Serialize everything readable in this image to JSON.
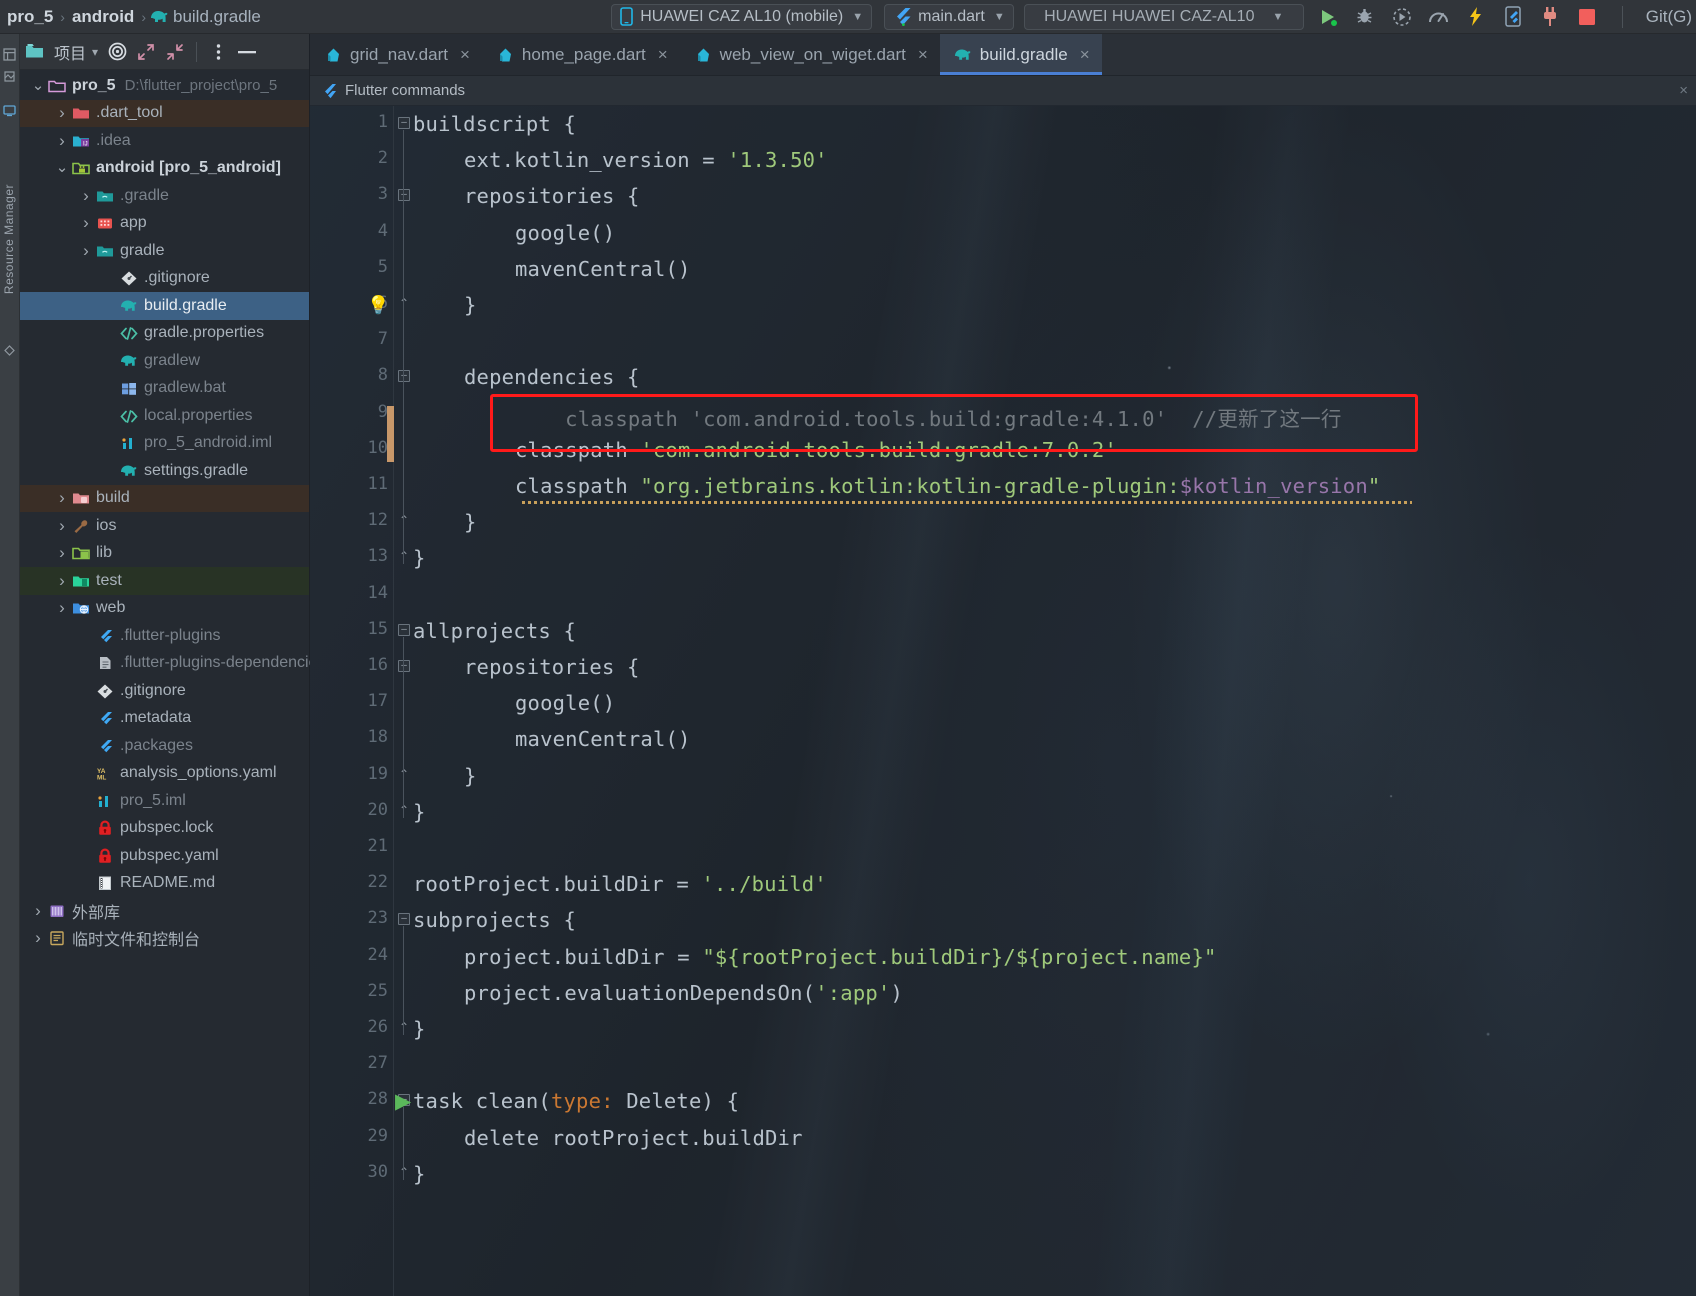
{
  "toolbar": {
    "breadcrumb": [
      {
        "label": "pro_5",
        "type": "project"
      },
      {
        "label": "android",
        "type": "module"
      },
      {
        "label": "build.gradle",
        "type": "file",
        "icon": "gradle-elephant-icon"
      }
    ],
    "device_selector": {
      "label": "HUAWEI CAZ AL10 (mobile)",
      "icon": "phone-icon"
    },
    "config_selector": {
      "label": "main.dart",
      "icon": "flutter-icon"
    },
    "target_selector": {
      "label": "HUAWEI HUAWEI CAZ-AL10"
    },
    "actions": [
      {
        "name": "run-button",
        "icon": "play-icon",
        "color": "#7dc87d"
      },
      {
        "name": "debug-button",
        "icon": "bug-icon",
        "color": "#9aa4ae"
      },
      {
        "name": "profile-button",
        "icon": "profile-clock-icon",
        "color": "#9aa4ae"
      },
      {
        "name": "performance-button",
        "icon": "gauge-icon",
        "color": "#9aa4ae"
      },
      {
        "name": "hot-reload-button",
        "icon": "lightning-icon",
        "color": "#f5c518"
      },
      {
        "name": "open-devtools-button",
        "icon": "device-flutter-icon",
        "color": "#76a9dd"
      },
      {
        "name": "attach-debugger-button",
        "icon": "plug-icon",
        "color": "#e08b82"
      },
      {
        "name": "stop-button",
        "icon": "stop-square-icon",
        "color": "#f25f5c"
      }
    ],
    "git_label": "Git(G)"
  },
  "rail": {
    "label": "Resource Manager"
  },
  "project_panel": {
    "title": "项目",
    "header_icons": [
      {
        "name": "project-view-icon"
      },
      {
        "name": "chevron-down-icon"
      },
      {
        "name": "target-locate-icon"
      },
      {
        "name": "expand-all-icon"
      },
      {
        "name": "collapse-all-icon"
      },
      {
        "name": "more-options-icon"
      },
      {
        "name": "hide-panel-icon"
      }
    ],
    "tree": [
      {
        "label": "pro_5",
        "sub": "D:\\flutter_project\\pro_5",
        "indent": 0,
        "arrow": "down",
        "icon": "folder-project-icon",
        "bold": true,
        "state": "normal"
      },
      {
        "label": ".dart_tool",
        "sub": "",
        "indent": 1,
        "arrow": "right",
        "icon": "folder-red-icon",
        "bold": false,
        "state": "build"
      },
      {
        "label": ".idea",
        "sub": "",
        "indent": 1,
        "arrow": "right",
        "icon": "folder-idea-icon",
        "bold": false,
        "state": "dim"
      },
      {
        "label": "android [pro_5_android]",
        "sub": "",
        "indent": 1,
        "arrow": "down",
        "icon": "folder-android-icon",
        "bold": true,
        "state": "normal"
      },
      {
        "label": ".gradle",
        "sub": "",
        "indent": 2,
        "arrow": "right",
        "icon": "folder-gradle-icon",
        "bold": false,
        "state": "dim"
      },
      {
        "label": "app",
        "sub": "",
        "indent": 2,
        "arrow": "right",
        "icon": "module-app-icon",
        "bold": false,
        "state": "normal"
      },
      {
        "label": "gradle",
        "sub": "",
        "indent": 2,
        "arrow": "right",
        "icon": "folder-gradle-icon",
        "bold": false,
        "state": "normal"
      },
      {
        "label": ".gitignore",
        "sub": "",
        "indent": 3,
        "arrow": "",
        "icon": "git-icon",
        "bold": false,
        "state": "normal"
      },
      {
        "label": "build.gradle",
        "sub": "",
        "indent": 3,
        "arrow": "",
        "icon": "gradle-elephant-icon",
        "bold": false,
        "state": "selected"
      },
      {
        "label": "gradle.properties",
        "sub": "",
        "indent": 3,
        "arrow": "",
        "icon": "code-tag-icon",
        "bold": false,
        "state": "normal"
      },
      {
        "label": "gradlew",
        "sub": "",
        "indent": 3,
        "arrow": "",
        "icon": "gradle-elephant-icon",
        "bold": false,
        "state": "dim"
      },
      {
        "label": "gradlew.bat",
        "sub": "",
        "indent": 3,
        "arrow": "",
        "icon": "windows-icon",
        "bold": false,
        "state": "dim"
      },
      {
        "label": "local.properties",
        "sub": "",
        "indent": 3,
        "arrow": "",
        "icon": "code-tag-icon",
        "bold": false,
        "state": "dim"
      },
      {
        "label": "pro_5_android.iml",
        "sub": "",
        "indent": 3,
        "arrow": "",
        "icon": "iml-icon",
        "bold": false,
        "state": "dim"
      },
      {
        "label": "settings.gradle",
        "sub": "",
        "indent": 3,
        "arrow": "",
        "icon": "gradle-elephant-icon",
        "bold": false,
        "state": "normal"
      },
      {
        "label": "build",
        "sub": "",
        "indent": 1,
        "arrow": "right",
        "icon": "folder-build-icon",
        "bold": false,
        "state": "build"
      },
      {
        "label": "ios",
        "sub": "",
        "indent": 1,
        "arrow": "right",
        "icon": "wrench-icon",
        "bold": false,
        "state": "normal"
      },
      {
        "label": "lib",
        "sub": "",
        "indent": 1,
        "arrow": "right",
        "icon": "folder-source-icon",
        "bold": false,
        "state": "normal"
      },
      {
        "label": "test",
        "sub": "",
        "indent": 1,
        "arrow": "right",
        "icon": "folder-test-icon",
        "bold": false,
        "state": "test"
      },
      {
        "label": "web",
        "sub": "",
        "indent": 1,
        "arrow": "right",
        "icon": "folder-web-icon",
        "bold": false,
        "state": "normal"
      },
      {
        "label": ".flutter-plugins",
        "sub": "",
        "indent": 2,
        "arrow": "",
        "icon": "flutter-icon",
        "bold": false,
        "state": "dim"
      },
      {
        "label": ".flutter-plugins-dependencies",
        "sub": "",
        "indent": 2,
        "arrow": "",
        "icon": "file-icon",
        "bold": false,
        "state": "dim"
      },
      {
        "label": ".gitignore",
        "sub": "",
        "indent": 2,
        "arrow": "",
        "icon": "git-icon",
        "bold": false,
        "state": "normal"
      },
      {
        "label": ".metadata",
        "sub": "",
        "indent": 2,
        "arrow": "",
        "icon": "flutter-icon",
        "bold": false,
        "state": "normal"
      },
      {
        "label": ".packages",
        "sub": "",
        "indent": 2,
        "arrow": "",
        "icon": "flutter-icon",
        "bold": false,
        "state": "dim"
      },
      {
        "label": "analysis_options.yaml",
        "sub": "",
        "indent": 2,
        "arrow": "",
        "icon": "yaml-icon",
        "bold": false,
        "state": "normal"
      },
      {
        "label": "pro_5.iml",
        "sub": "",
        "indent": 2,
        "arrow": "",
        "icon": "iml-icon",
        "bold": false,
        "state": "dim"
      },
      {
        "label": "pubspec.lock",
        "sub": "",
        "indent": 2,
        "arrow": "",
        "icon": "lock-icon",
        "bold": false,
        "state": "normal"
      },
      {
        "label": "pubspec.yaml",
        "sub": "",
        "indent": 2,
        "arrow": "",
        "icon": "lock-icon",
        "bold": false,
        "state": "normal"
      },
      {
        "label": "README.md",
        "sub": "",
        "indent": 2,
        "arrow": "",
        "icon": "readme-icon",
        "bold": false,
        "state": "normal"
      },
      {
        "label": "外部库",
        "sub": "",
        "indent": 0,
        "arrow": "right",
        "icon": "external-lib-icon",
        "bold": false,
        "state": "normal"
      },
      {
        "label": "临时文件和控制台",
        "sub": "",
        "indent": 0,
        "arrow": "right",
        "icon": "scratches-icon",
        "bold": false,
        "state": "normal"
      }
    ]
  },
  "editor": {
    "tabs": [
      {
        "label": "grid_nav.dart",
        "icon": "dart-icon",
        "active": false,
        "closable": true
      },
      {
        "label": "home_page.dart",
        "icon": "dart-icon",
        "active": false,
        "closable": true
      },
      {
        "label": "web_view_on_wiget.dart",
        "icon": "dart-icon",
        "active": false,
        "closable": true
      },
      {
        "label": "build.gradle",
        "icon": "gradle-elephant-icon",
        "active": true,
        "closable": true
      }
    ],
    "notification_bar": {
      "label": "Flutter commands",
      "icon": "flutter-icon",
      "close": "×"
    },
    "lines": [
      {
        "n": 1,
        "indent": 0,
        "tokens": [
          {
            "t": "buildscript {",
            "c": "c-def"
          }
        ]
      },
      {
        "n": 2,
        "indent": 2,
        "tokens": [
          {
            "t": "ext.kotlin_version = ",
            "c": "c-def"
          },
          {
            "t": "'1.3.50'",
            "c": "c-str"
          }
        ]
      },
      {
        "n": 3,
        "indent": 2,
        "tokens": [
          {
            "t": "repositories {",
            "c": "c-def"
          }
        ]
      },
      {
        "n": 4,
        "indent": 4,
        "tokens": [
          {
            "t": "google()",
            "c": "c-def"
          }
        ]
      },
      {
        "n": 5,
        "indent": 4,
        "tokens": [
          {
            "t": "mavenCentral()",
            "c": "c-def"
          }
        ]
      },
      {
        "n": 6,
        "indent": 2,
        "tokens": [
          {
            "t": "}",
            "c": "c-def"
          }
        ]
      },
      {
        "n": 7,
        "indent": 0,
        "tokens": []
      },
      {
        "n": 8,
        "indent": 2,
        "tokens": [
          {
            "t": "dependencies {",
            "c": "c-def"
          }
        ]
      },
      {
        "n": 9,
        "indent": 4,
        "tokens": [
          {
            "t": "    classpath 'com.android.tools.build:gradle:4.1.0'  //更新了这一行",
            "c": "c-cmt"
          }
        ]
      },
      {
        "n": 10,
        "indent": 4,
        "tokens": [
          {
            "t": "classpath ",
            "c": "c-def"
          },
          {
            "t": "'com.android.tools.build:gradle:7.0.2'",
            "c": "c-str"
          }
        ]
      },
      {
        "n": 11,
        "indent": 4,
        "tokens": [
          {
            "t": "classpath ",
            "c": "c-def"
          },
          {
            "t": "\"org.jetbrains.kotlin:kotlin-gradle-plugin:",
            "c": "c-str"
          },
          {
            "t": "$kotlin_version",
            "c": "c-var"
          },
          {
            "t": "\"",
            "c": "c-str"
          }
        ]
      },
      {
        "n": 12,
        "indent": 2,
        "tokens": [
          {
            "t": "}",
            "c": "c-def"
          }
        ]
      },
      {
        "n": 13,
        "indent": 0,
        "tokens": [
          {
            "t": "}",
            "c": "c-def"
          }
        ]
      },
      {
        "n": 14,
        "indent": 0,
        "tokens": []
      },
      {
        "n": 15,
        "indent": 0,
        "tokens": [
          {
            "t": "allprojects {",
            "c": "c-def"
          }
        ]
      },
      {
        "n": 16,
        "indent": 2,
        "tokens": [
          {
            "t": "repositories {",
            "c": "c-def"
          }
        ]
      },
      {
        "n": 17,
        "indent": 4,
        "tokens": [
          {
            "t": "google()",
            "c": "c-def"
          }
        ]
      },
      {
        "n": 18,
        "indent": 4,
        "tokens": [
          {
            "t": "mavenCentral()",
            "c": "c-def"
          }
        ]
      },
      {
        "n": 19,
        "indent": 2,
        "tokens": [
          {
            "t": "}",
            "c": "c-def"
          }
        ]
      },
      {
        "n": 20,
        "indent": 0,
        "tokens": [
          {
            "t": "}",
            "c": "c-def"
          }
        ]
      },
      {
        "n": 21,
        "indent": 0,
        "tokens": []
      },
      {
        "n": 22,
        "indent": 0,
        "tokens": [
          {
            "t": "rootProject.buildDir = ",
            "c": "c-def"
          },
          {
            "t": "'../build'",
            "c": "c-str"
          }
        ]
      },
      {
        "n": 23,
        "indent": 0,
        "tokens": [
          {
            "t": "subprojects {",
            "c": "c-def"
          }
        ]
      },
      {
        "n": 24,
        "indent": 2,
        "tokens": [
          {
            "t": "project.buildDir = ",
            "c": "c-def"
          },
          {
            "t": "\"${rootProject.buildDir}/${project.name}\"",
            "c": "c-str"
          }
        ]
      },
      {
        "n": 25,
        "indent": 2,
        "tokens": [
          {
            "t": "project.evaluationDependsOn(",
            "c": "c-def"
          },
          {
            "t": "':app'",
            "c": "c-str"
          },
          {
            "t": ")",
            "c": "c-def"
          }
        ]
      },
      {
        "n": 26,
        "indent": 0,
        "tokens": [
          {
            "t": "}",
            "c": "c-def"
          }
        ]
      },
      {
        "n": 27,
        "indent": 0,
        "tokens": []
      },
      {
        "n": 28,
        "indent": 0,
        "tokens": [
          {
            "t": "task clean(",
            "c": "c-def"
          },
          {
            "t": "type: ",
            "c": "c-kw"
          },
          {
            "t": "Delete) {",
            "c": "c-def"
          }
        ]
      },
      {
        "n": 29,
        "indent": 2,
        "tokens": [
          {
            "t": "delete rootProject.buildDir",
            "c": "c-def"
          }
        ]
      },
      {
        "n": 30,
        "indent": 0,
        "tokens": [
          {
            "t": "}",
            "c": "c-def"
          }
        ]
      }
    ],
    "highlight_annotation": {
      "name": "red-highlight-box",
      "color": "#ff1a1a",
      "covers_lines": [
        9,
        10
      ]
    }
  },
  "colors": {
    "accent": "#4a7fd4",
    "selection": "#3d6185",
    "editor_bg": "#1e242b",
    "panel_bg": "#252a31",
    "string": "#9fc97b",
    "comment": "#72797f",
    "highlight_red": "#ff1a1a"
  }
}
